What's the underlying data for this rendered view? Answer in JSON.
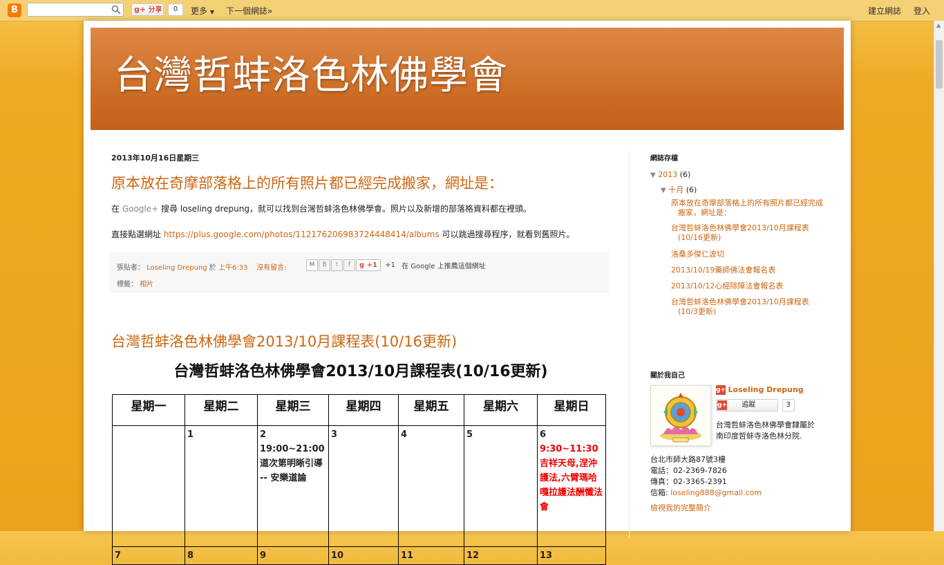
{
  "navbar": {
    "search_placeholder": "",
    "share_label": "分享",
    "share_count": "0",
    "more_label": "更多",
    "next_blog_label": "下一個網誌»",
    "create_blog_label": "建立網誌",
    "login_label": "登入"
  },
  "header": {
    "title": "台灣哲蚌洛色林佛學會"
  },
  "post1": {
    "date": "2013年10月16日星期三",
    "title": "原本放在奇摩部落格上的所有照片都已經完成搬家，網址是：",
    "line1_prefix": "在 ",
    "line1_link": "Google+",
    "line1_suffix": " 搜尋 loseling drepung，就可以找到台灣哲蚌洛色林佛學會。照片以及新增的部落格資料都在裡頭。",
    "line2_prefix": "直接點選網址 ",
    "line2_link": "https://plus.google.com/photos/112176206983724448414/albums",
    "line2_suffix": " 可以跳過搜尋程序，就看到舊照片。",
    "footer": {
      "posted_by_label": "張貼者：",
      "author": "Loseling Drepung",
      "at_label": "於",
      "time": "上午6:33",
      "comments": "沒有留言:",
      "plus_one": "+1",
      "plus_one_count": "+1",
      "recommend": "在 Google 上推薦這個網址",
      "labels_label": "標籤：",
      "label_value": "相片"
    }
  },
  "post2": {
    "title": "台灣哲蚌洛色林佛學會2013/10月課程表(10/16更新)",
    "schedule_title": "台灣哲蚌洛色林佛學會2013/10月課程表(10/16更新)",
    "days": [
      "星期一",
      "星期二",
      "星期三",
      "星期四",
      "星期五",
      "星期六",
      "星期日"
    ],
    "week1": {
      "d1": "",
      "d2": "1",
      "d3": "2",
      "d3_time": "19:00~21:00",
      "d3_event": "道次第明晰引導 -- 安樂道論",
      "d4": "3",
      "d5": "4",
      "d6": "5",
      "d7": "6",
      "d7_time": "9:30~11:30",
      "d7_event": "吉祥天母,涅沖護法,六臂瑪哈嘎拉護法酬懺法會"
    },
    "week2": [
      "7",
      "8",
      "9",
      "10",
      "11",
      "12",
      "13"
    ]
  },
  "sidebar": {
    "archive_title": "網誌存檔",
    "year": "2013",
    "year_count": "(6)",
    "month": "十月",
    "month_count": "(6)",
    "posts": [
      "原本放在奇摩部落格上的所有照片都已經完成搬家，網址是：",
      "台灣哲蚌洛色林佛學會2013/10月課程表(10/16更新)",
      "洛桑多傑仁波切",
      "2013/10/19藥師佛法會報名表",
      "2013/10/12心經除障法會報名表",
      "台灣哲蚌洛色林佛學會2013/10月課程表(10/3更新)"
    ],
    "about_title": "關於我自己",
    "profile_name": "Loseling Drepung",
    "follow_label": "追蹤",
    "follow_count": "3",
    "desc1": "台灣哲蚌洛色林佛學會隸屬於南印度哲蚌寺洛色林分院.",
    "address": "台北市師大路87號3樓",
    "phone": "電話：02-2369-7826",
    "fax": "傳真：02-3365-2391",
    "email_label": "信箱:",
    "email": "loseling888@gmail.com",
    "full_profile": "檢視我的完整簡介"
  },
  "colors": {
    "accent": "#cc6611",
    "header_bg": "#cc6a22",
    "navbar_bg": "#f5d175"
  }
}
